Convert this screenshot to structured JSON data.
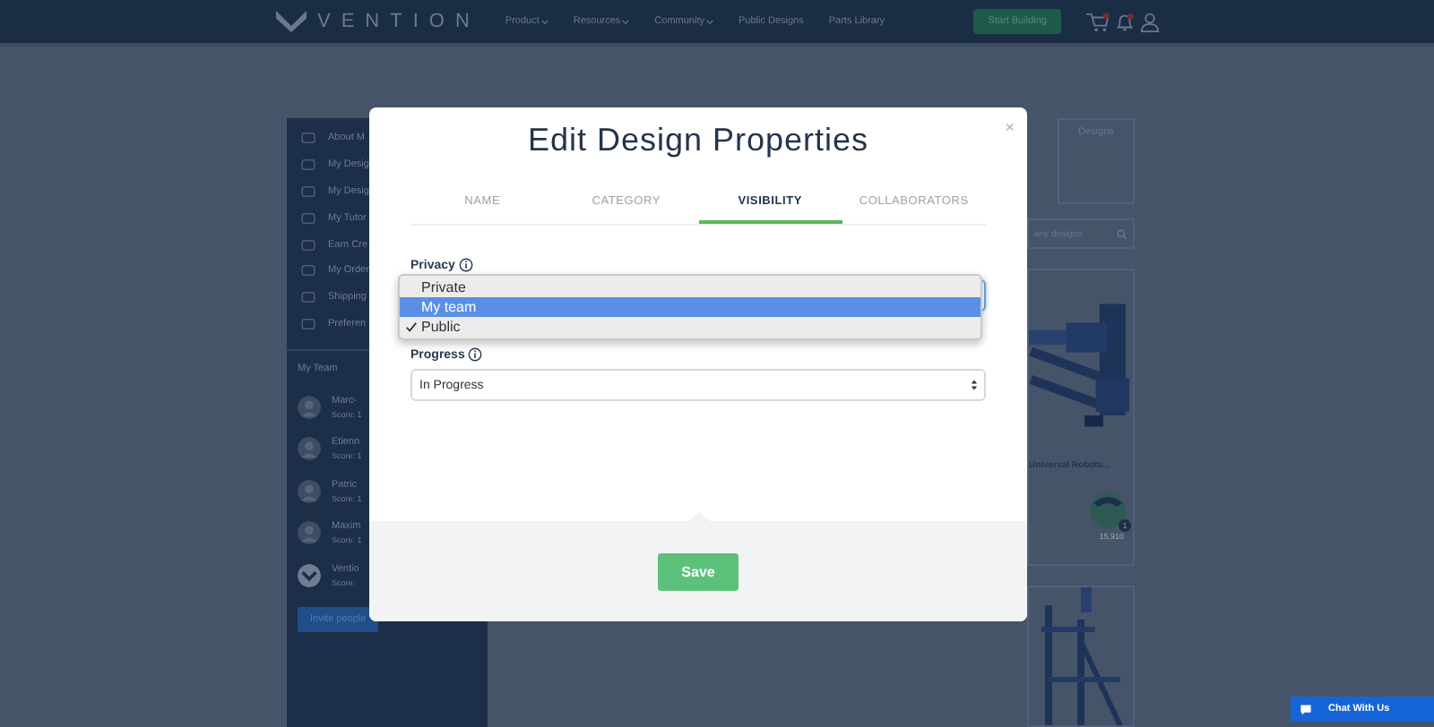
{
  "nav": {
    "logo": "VENTION",
    "links": [
      {
        "label": "Product",
        "dropdown": true
      },
      {
        "label": "Resources",
        "dropdown": true
      },
      {
        "label": "Community",
        "dropdown": true
      },
      {
        "label": "Public Designs",
        "dropdown": false
      },
      {
        "label": "Parts Library",
        "dropdown": false
      }
    ],
    "cta": "Start Building"
  },
  "sidebar": {
    "menu": [
      "About M",
      "My Desig",
      "My Desig",
      "My Tutor",
      "Earn Cre",
      "My Order",
      "Shipping",
      "Preferen"
    ],
    "team_heading": "My Team",
    "members": [
      {
        "name": "Marc-",
        "score": "Score: 1",
        "kind": "person"
      },
      {
        "name": "Etienn",
        "score": "Score: 1",
        "kind": "person"
      },
      {
        "name": "Patric",
        "score": "Score: 1",
        "kind": "person"
      },
      {
        "name": "Maxim",
        "score": "Score: 1",
        "kind": "person"
      },
      {
        "name": "Ventio",
        "score": "Score:",
        "kind": "logo"
      }
    ],
    "invite": "Invite people"
  },
  "main": {
    "tab": "Designs",
    "search_placeholder": "any designs",
    "cards": [
      {
        "kind": "design",
        "title": "Universal Robots...",
        "count": "15,910",
        "badge": "1"
      },
      {
        "kind": "picture"
      }
    ]
  },
  "modal": {
    "title": "Edit Design Properties",
    "close": "×",
    "tabs": [
      {
        "label": "NAME",
        "selected": false
      },
      {
        "label": "CATEGORY",
        "selected": false
      },
      {
        "label": "VISIBILITY",
        "selected": true
      },
      {
        "label": "COLLABORATORS",
        "selected": false
      }
    ],
    "privacy": {
      "label": "Privacy",
      "options": [
        {
          "label": "Private",
          "selected": false,
          "checked": false
        },
        {
          "label": "My team",
          "selected": true,
          "checked": false
        },
        {
          "label": "Public",
          "selected": false,
          "checked": true
        }
      ]
    },
    "progress": {
      "label": "Progress",
      "value": "In Progress"
    },
    "save": "Save"
  },
  "chat": "Chat With Us"
}
